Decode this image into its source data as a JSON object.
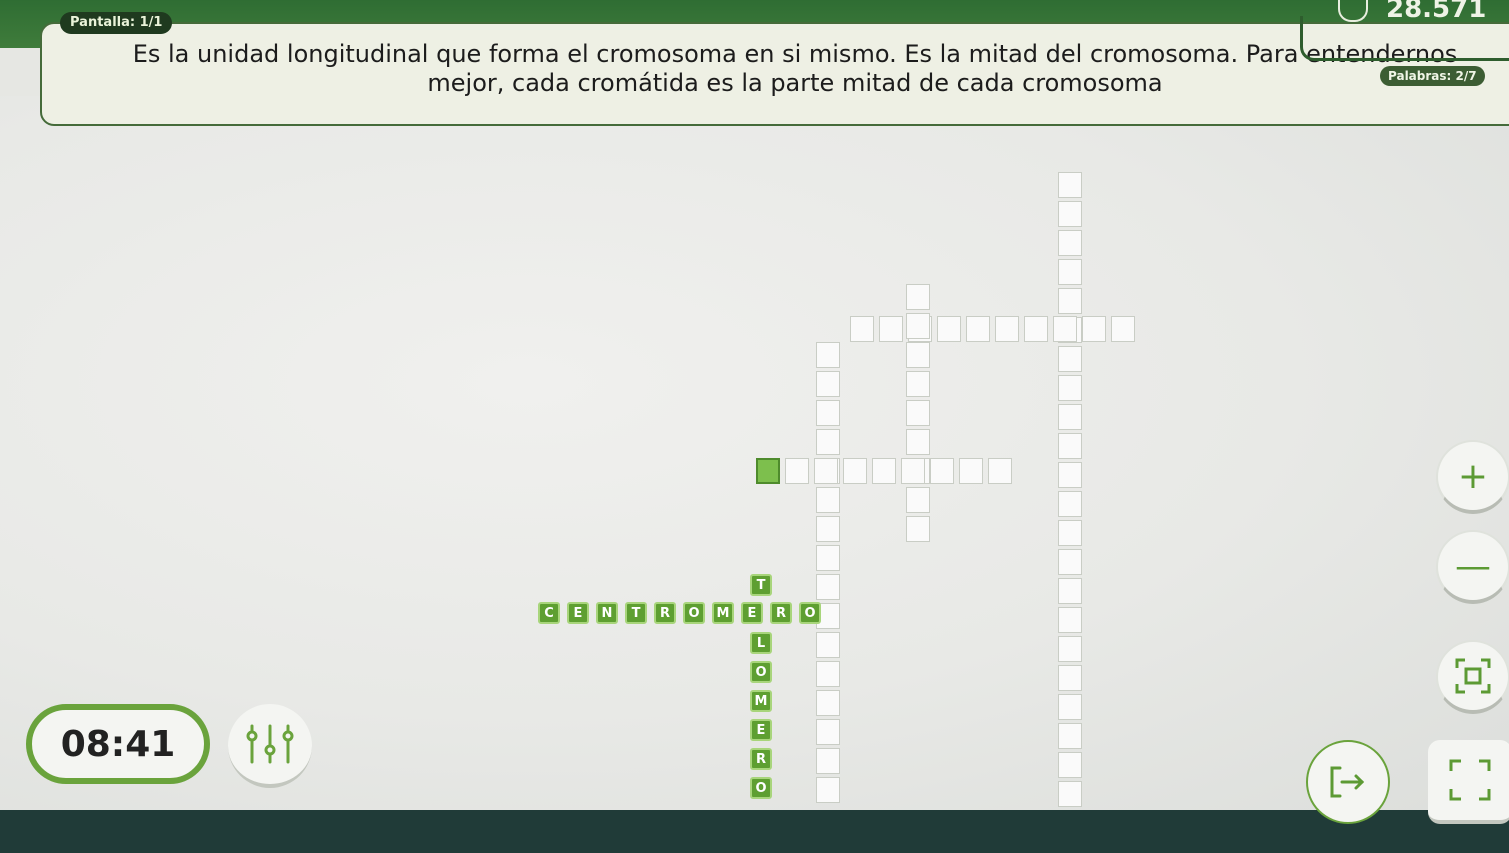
{
  "header": {
    "screen_label": "Pantalla: 1/1",
    "score": "28.571",
    "score_icon": "clock-icon",
    "words_label": "Palabras: 2/7"
  },
  "clue": {
    "text": "Es la unidad longitudinal que forma el cromosoma en si mismo. Es la mitad del cromosoma. Para entendernos mejor, cada cromátida es la parte mitad de cada cromosoma"
  },
  "crossword": {
    "solved_words": [
      {
        "word": "CENTROMERO",
        "direction": "across"
      },
      {
        "word": "TELOMERO",
        "direction": "down"
      }
    ]
  },
  "controls": {
    "timer": "08:41",
    "zoom_in_icon": "plus-icon",
    "zoom_out_icon": "minus-icon",
    "center_icon": "center-view-icon",
    "settings_icon": "sliders-icon",
    "exit_icon": "exit-icon",
    "fullscreen_icon": "fullscreen-icon"
  },
  "colors": {
    "accent": "#6aa33c",
    "header_green": "#3f7c3b",
    "solved_tile": "#5e9f31",
    "selected_cell": "#7dbf4d"
  }
}
